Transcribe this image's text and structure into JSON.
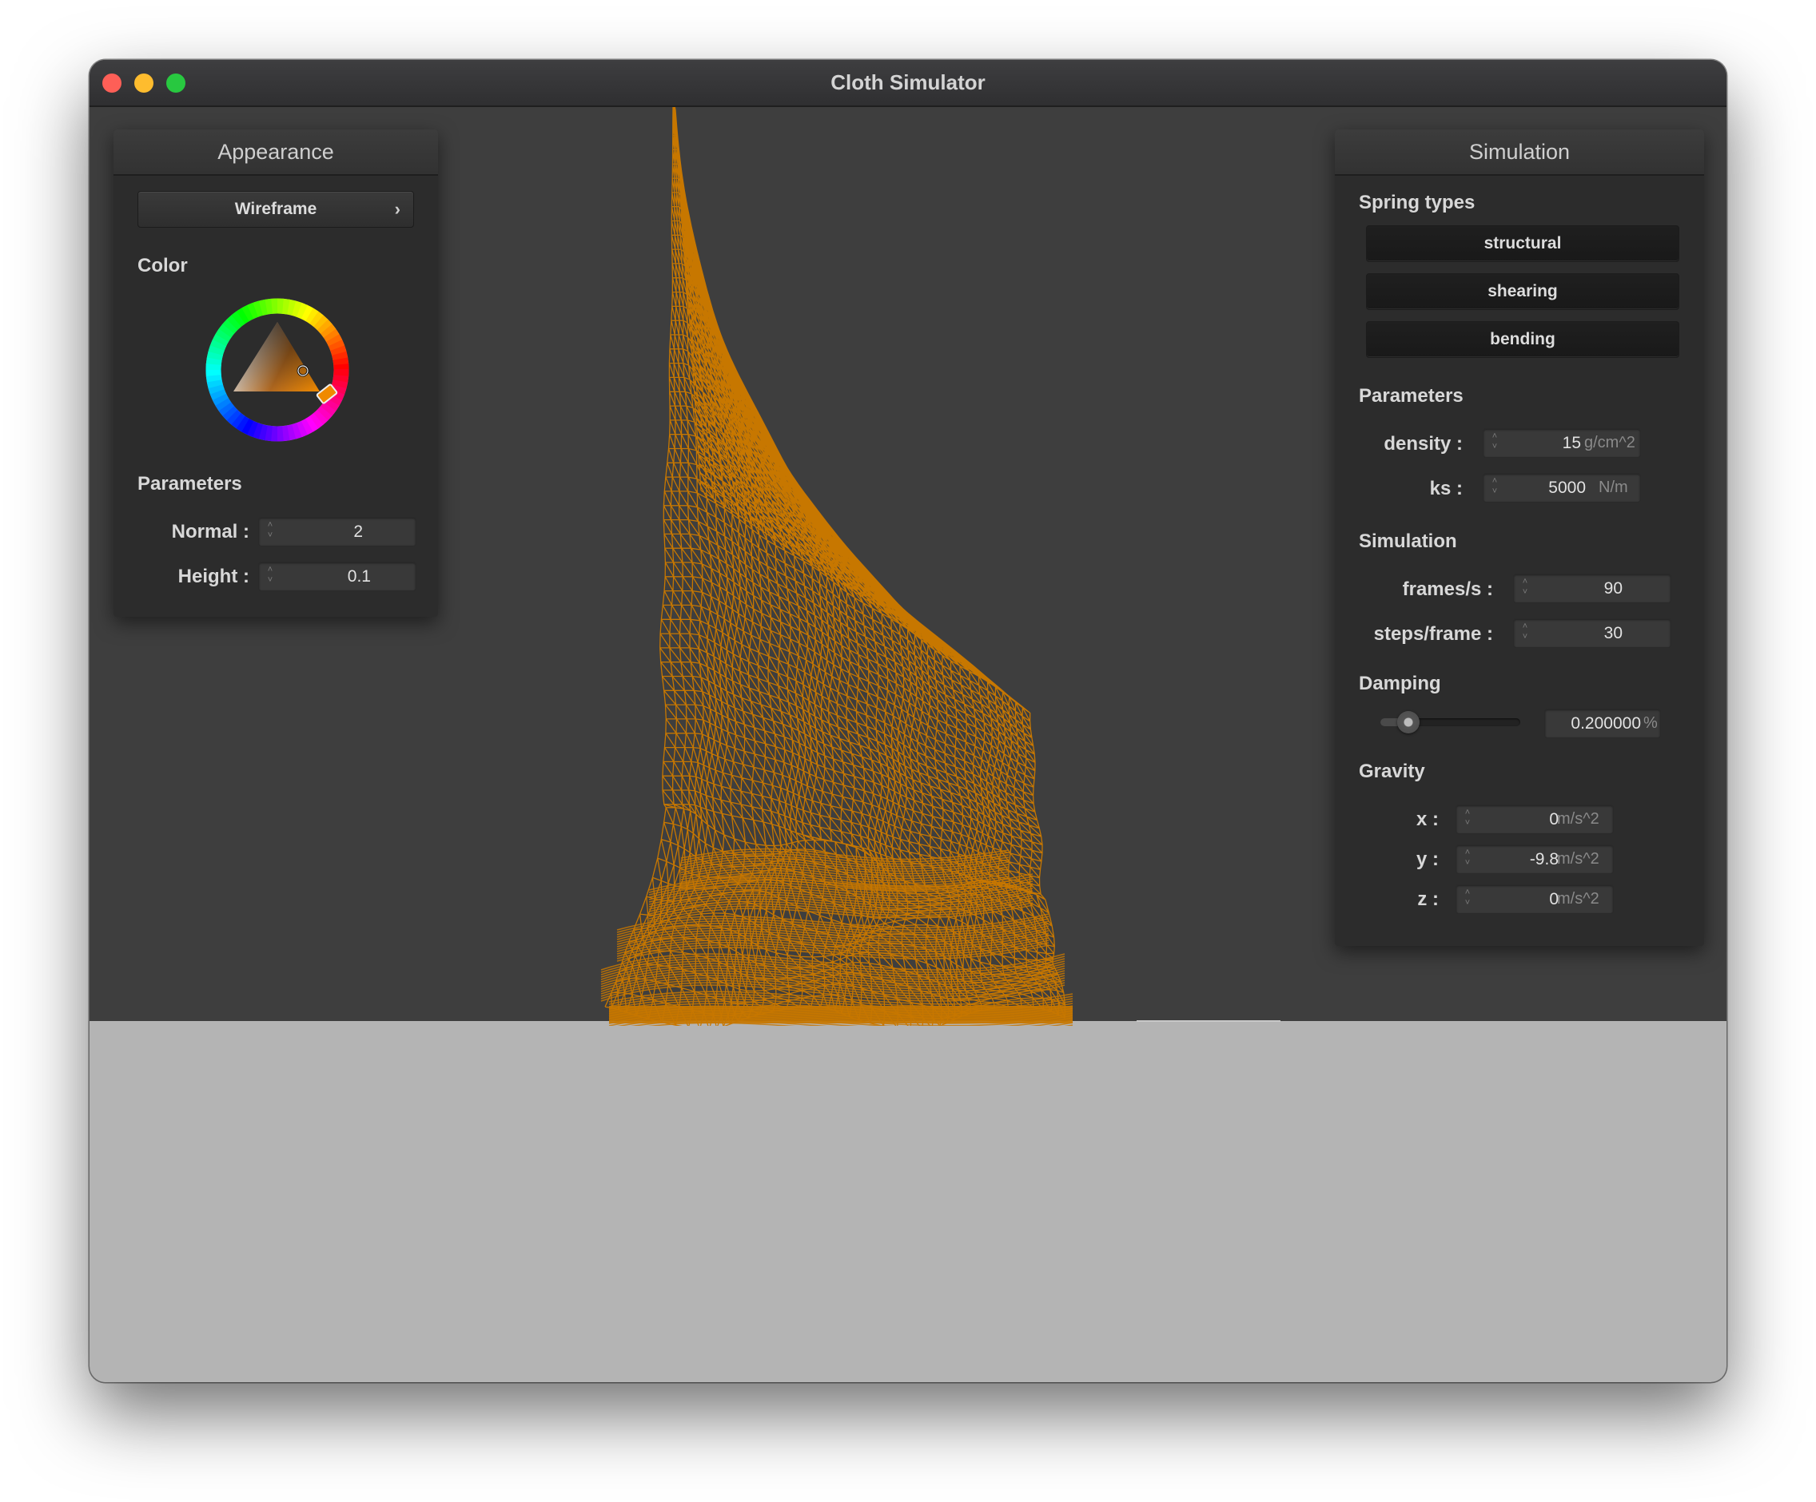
{
  "window": {
    "title": "Cloth Simulator"
  },
  "appearance": {
    "header": "Appearance",
    "shader_button": "Wireframe",
    "color_label": "Color",
    "parameters_label": "Parameters",
    "normal_label": "Normal :",
    "normal_value": "2",
    "height_label": "Height :",
    "height_value": "0.1",
    "selected_color": "#c77700"
  },
  "simulation_panel": {
    "header": "Simulation",
    "spring_types_label": "Spring types",
    "spring_buttons": [
      "structural",
      "shearing",
      "bending"
    ],
    "parameters_label": "Parameters",
    "density_label": "density :",
    "density_value": "15",
    "density_unit": "g/cm^2",
    "ks_label": "ks :",
    "ks_value": "5000",
    "ks_unit": "N/m",
    "simulation_label": "Simulation",
    "fps_label": "frames/s :",
    "fps_value": "90",
    "steps_label": "steps/frame :",
    "steps_value": "30",
    "damping_label": "Damping",
    "damping_value": "0.200000",
    "damping_unit": "%",
    "damping_fraction": 0.2,
    "gravity_label": "Gravity",
    "gravity": [
      {
        "label": "x :",
        "value": "0",
        "unit": "m/s^2"
      },
      {
        "label": "y :",
        "value": "-9.8",
        "unit": "m/s^2"
      },
      {
        "label": "z :",
        "value": "0",
        "unit": "m/s^2"
      }
    ]
  },
  "colors": {
    "cloth": "#c77700",
    "viewport_bg": "#3e3e3e",
    "ground": "#b4b4b4"
  }
}
